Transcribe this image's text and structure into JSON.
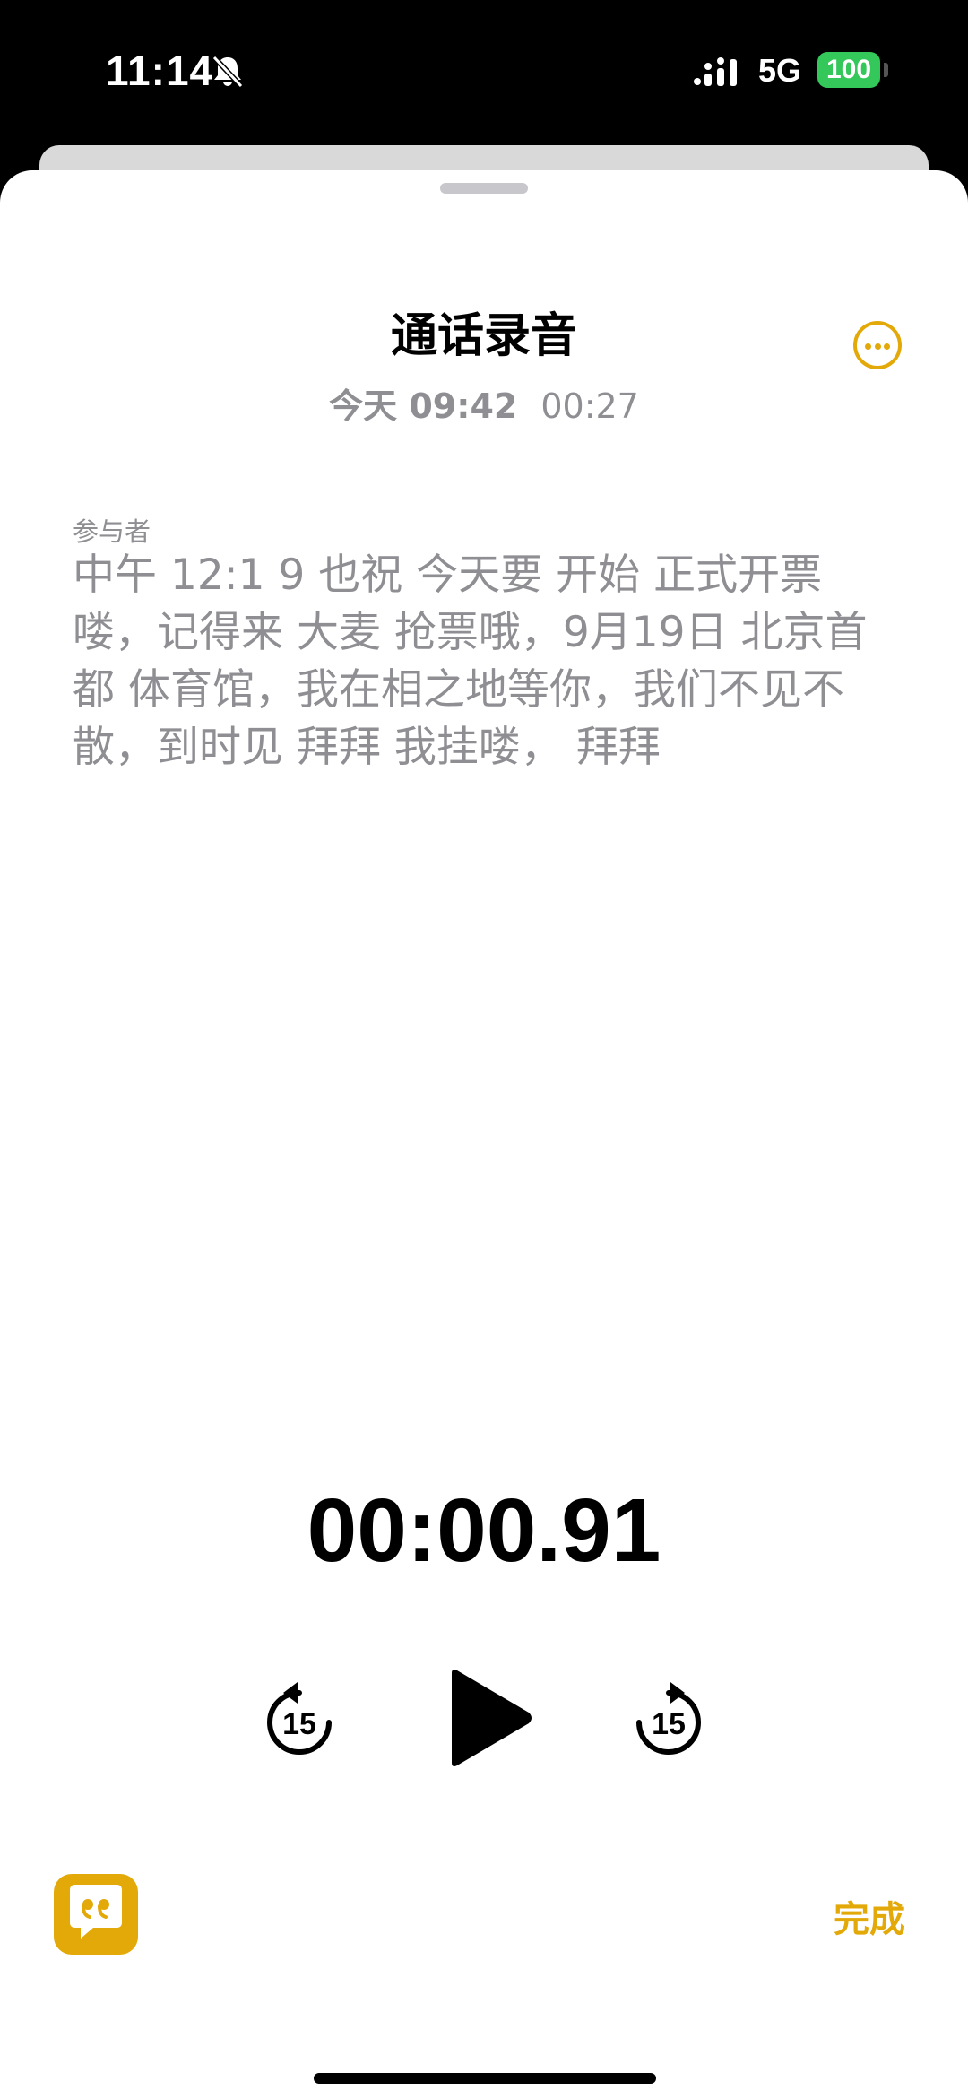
{
  "status_bar": {
    "time": "11:14",
    "network": "5G",
    "battery": "100",
    "icons": [
      "bell-slash-icon",
      "signal-icon"
    ]
  },
  "recording": {
    "title": "通话录音",
    "date": "今天 09:42",
    "duration": "00:27",
    "participants_label": "参与者",
    "transcript": "中午 12:1 9 也祝 今天要 开始 正式开票喽，记得来 大麦 抢票哦，9月19日 北京首都 体育馆，我在相之地等你，我们不见不散，到时见 拜拜 我挂喽， 拜拜"
  },
  "player": {
    "elapsed": "00:00.91",
    "skip_back_seconds": "15",
    "skip_forward_seconds": "15"
  },
  "footer": {
    "done_label": "完成"
  },
  "colors": {
    "accent": "#e3a908",
    "secondary_text": "#8e8e93",
    "battery": "#34c759"
  }
}
